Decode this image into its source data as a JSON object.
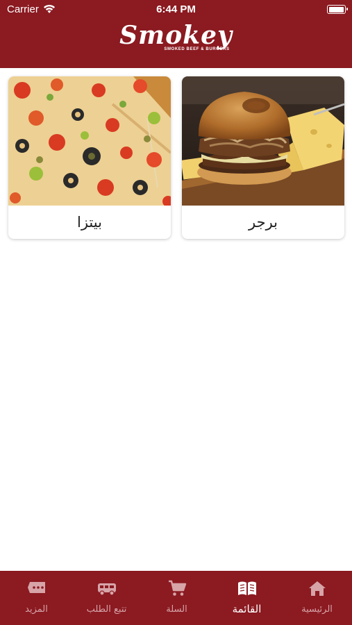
{
  "status_bar": {
    "carrier": "Carrier",
    "time": "6:44 PM",
    "battery_level": 1.0
  },
  "header": {
    "logo_title": "Smokey",
    "logo_subtitle": "SMOKED BEEF & BURGERS"
  },
  "categories": [
    {
      "label": "برجر",
      "image": "burger"
    },
    {
      "label": "بيتزا",
      "image": "pizza"
    }
  ],
  "tabbar": {
    "active": "menu",
    "tabs": [
      {
        "label": "الرئيسية",
        "icon": "home-icon"
      },
      {
        "label": "القائمة",
        "icon": "menu-book-icon"
      },
      {
        "label": "السلة",
        "icon": "cart-icon"
      },
      {
        "label": "تتبع الطلب",
        "icon": "truck-icon"
      },
      {
        "label": "المزيد",
        "icon": "more-icon"
      }
    ]
  },
  "colors": {
    "brand": "#8b1a21",
    "inactive_tab": "#d7a4a8"
  }
}
